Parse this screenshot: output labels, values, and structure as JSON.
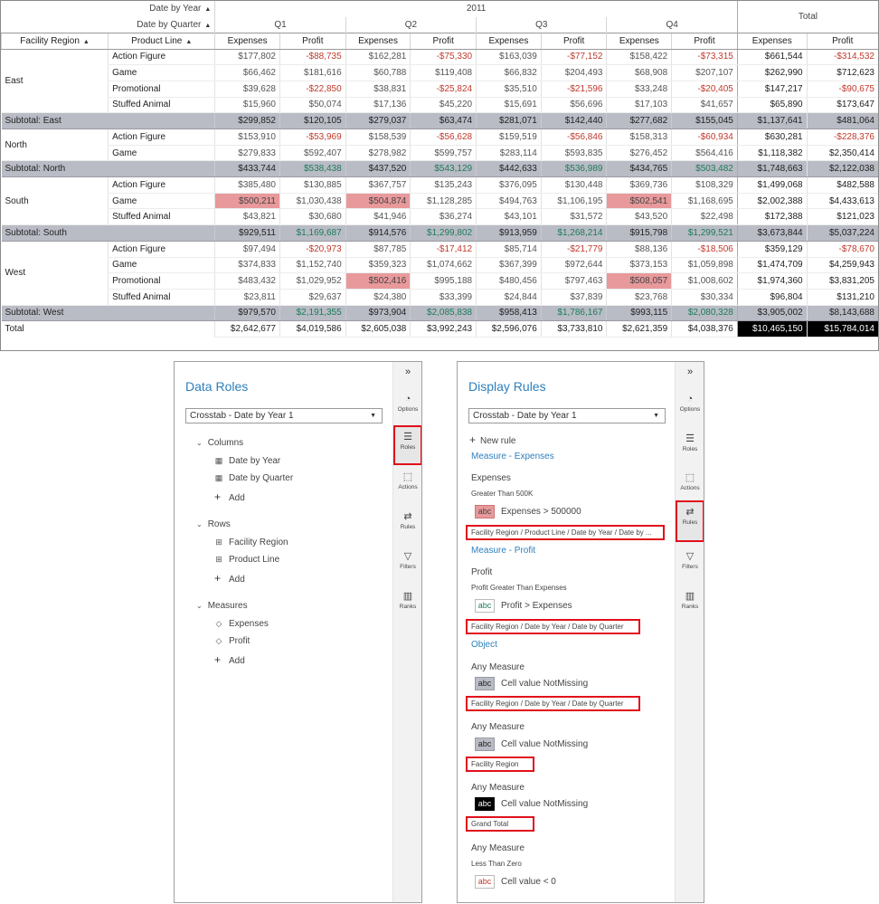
{
  "crosstab": {
    "col_dims": [
      "Date by Year",
      "Date by Quarter"
    ],
    "year": "2011",
    "quarters": [
      "Q1",
      "Q2",
      "Q3",
      "Q4"
    ],
    "total_label": "Total",
    "row_headers": [
      "Facility Region",
      "Product Line"
    ],
    "measures": [
      "Expenses",
      "Profit"
    ],
    "rows": [
      {
        "type": "data",
        "region": "East",
        "product": "Action Figure",
        "values": [
          "$177,802",
          "-$88,735",
          "$162,281",
          "-$75,330",
          "$163,039",
          "-$77,152",
          "$158,422",
          "-$73,315"
        ],
        "totals": [
          "$661,544",
          "-$314,532"
        ]
      },
      {
        "type": "data",
        "region": "",
        "product": "Game",
        "values": [
          "$66,462",
          "$181,616",
          "$60,788",
          "$119,408",
          "$66,832",
          "$204,493",
          "$68,908",
          "$207,107"
        ],
        "totals": [
          "$262,990",
          "$712,623"
        ]
      },
      {
        "type": "data",
        "region": "",
        "product": "Promotional",
        "values": [
          "$39,628",
          "-$22,850",
          "$38,831",
          "-$25,824",
          "$35,510",
          "-$21,596",
          "$33,248",
          "-$20,405"
        ],
        "totals": [
          "$147,217",
          "-$90,675"
        ]
      },
      {
        "type": "data",
        "region": "",
        "product": "Stuffed Animal",
        "values": [
          "$15,960",
          "$50,074",
          "$17,136",
          "$45,220",
          "$15,691",
          "$56,696",
          "$17,103",
          "$41,657"
        ],
        "totals": [
          "$65,890",
          "$173,647"
        ]
      },
      {
        "type": "sub",
        "label": "Subtotal: East",
        "values": [
          "$299,852",
          "$120,105",
          "$279,037",
          "$63,474",
          "$281,071",
          "$142,440",
          "$277,682",
          "$155,045"
        ],
        "totals": [
          "$1,137,641",
          "$481,064"
        ]
      },
      {
        "type": "data",
        "region": "North",
        "product": "Action Figure",
        "values": [
          "$153,910",
          "-$53,969",
          "$158,539",
          "-$56,628",
          "$159,519",
          "-$56,846",
          "$158,313",
          "-$60,934"
        ],
        "totals": [
          "$630,281",
          "-$228,376"
        ]
      },
      {
        "type": "data",
        "region": "",
        "product": "Game",
        "values": [
          "$279,833",
          "$592,407",
          "$278,982",
          "$599,757",
          "$283,114",
          "$593,835",
          "$276,452",
          "$564,416"
        ],
        "totals": [
          "$1,118,382",
          "$2,350,414"
        ]
      },
      {
        "type": "sub",
        "label": "Subtotal: North",
        "values": [
          "$433,744",
          "$538,438",
          "$437,520",
          "$543,129",
          "$442,633",
          "$536,989",
          "$434,765",
          "$503,482"
        ],
        "totals": [
          "$1,748,663",
          "$2,122,038"
        ]
      },
      {
        "type": "data",
        "region": "South",
        "product": "Action Figure",
        "values": [
          "$385,480",
          "$130,885",
          "$367,757",
          "$135,243",
          "$376,095",
          "$130,448",
          "$369,736",
          "$108,329"
        ],
        "totals": [
          "$1,499,068",
          "$482,588"
        ]
      },
      {
        "type": "data",
        "region": "",
        "product": "Game",
        "values": [
          "$500,211",
          "$1,030,438",
          "$504,874",
          "$1,128,285",
          "$494,763",
          "$1,106,195",
          "$502,541",
          "$1,168,695"
        ],
        "totals": [
          "$2,002,388",
          "$4,433,613"
        ]
      },
      {
        "type": "data",
        "region": "",
        "product": "Stuffed Animal",
        "values": [
          "$43,821",
          "$30,680",
          "$41,946",
          "$36,274",
          "$43,101",
          "$31,572",
          "$43,520",
          "$22,498"
        ],
        "totals": [
          "$172,388",
          "$121,023"
        ]
      },
      {
        "type": "sub",
        "label": "Subtotal: South",
        "values": [
          "$929,511",
          "$1,169,687",
          "$914,576",
          "$1,299,802",
          "$913,959",
          "$1,268,214",
          "$915,798",
          "$1,299,521"
        ],
        "totals": [
          "$3,673,844",
          "$5,037,224"
        ]
      },
      {
        "type": "data",
        "region": "West",
        "product": "Action Figure",
        "values": [
          "$97,494",
          "-$20,973",
          "$87,785",
          "-$17,412",
          "$85,714",
          "-$21,779",
          "$88,136",
          "-$18,506"
        ],
        "totals": [
          "$359,129",
          "-$78,670"
        ]
      },
      {
        "type": "data",
        "region": "",
        "product": "Game",
        "values": [
          "$374,833",
          "$1,152,740",
          "$359,323",
          "$1,074,662",
          "$367,399",
          "$972,644",
          "$373,153",
          "$1,059,898"
        ],
        "totals": [
          "$1,474,709",
          "$4,259,943"
        ]
      },
      {
        "type": "data",
        "region": "",
        "product": "Promotional",
        "values": [
          "$483,432",
          "$1,029,952",
          "$502,416",
          "$995,188",
          "$480,456",
          "$797,463",
          "$508,057",
          "$1,008,602"
        ],
        "totals": [
          "$1,974,360",
          "$3,831,205"
        ]
      },
      {
        "type": "data",
        "region": "",
        "product": "Stuffed Animal",
        "values": [
          "$23,811",
          "$29,637",
          "$24,380",
          "$33,399",
          "$24,844",
          "$37,839",
          "$23,768",
          "$30,334"
        ],
        "totals": [
          "$96,804",
          "$131,210"
        ]
      },
      {
        "type": "sub",
        "label": "Subtotal: West",
        "values": [
          "$979,570",
          "$2,191,355",
          "$973,904",
          "$2,085,838",
          "$958,413",
          "$1,786,167",
          "$993,115",
          "$2,080,328"
        ],
        "totals": [
          "$3,905,002",
          "$8,143,688"
        ]
      },
      {
        "type": "grand",
        "label": "Total",
        "values": [
          "$2,642,677",
          "$4,019,586",
          "$2,605,038",
          "$3,992,243",
          "$2,596,076",
          "$3,733,810",
          "$2,621,359",
          "$4,038,376"
        ],
        "totals": [
          "$10,465,150",
          "$15,784,014"
        ]
      }
    ],
    "colors": {
      "highlight": "#e8999b",
      "subtotal_bg": "#b9bcc5",
      "negative": "#c0392b",
      "positive_sub": "#1f7a5a",
      "grand_bg": "#000000"
    }
  },
  "data_roles": {
    "title": "Data Roles",
    "dropdown": "Crosstab - Date by Year 1",
    "sections": [
      {
        "label": "Columns",
        "items": [
          "Date by Year",
          "Date by Quarter"
        ],
        "icon": "calendar-icon"
      },
      {
        "label": "Rows",
        "items": [
          "Facility Region",
          "Product Line"
        ],
        "icon": "hierarchy-icon"
      },
      {
        "label": "Measures",
        "items": [
          "Expenses",
          "Profit"
        ],
        "icon": "measure-icon"
      }
    ],
    "add_label": "Add"
  },
  "display_rules": {
    "title": "Display Rules",
    "dropdown": "Crosstab - Date by Year 1",
    "new_rule": "New rule",
    "groups": [
      {
        "link": "Measure - Expenses",
        "name": "Expenses",
        "subtitle": "Greater Than 500K",
        "swatch": "abc",
        "condition": "Expenses > 500000",
        "scope": "Facility Region / Product Line / Date by Year / Date by ..."
      },
      {
        "link": "Measure - Profit",
        "name": "Profit",
        "subtitle": "Profit Greater Than Expenses",
        "swatch": "abc",
        "condition": "Profit > Expenses",
        "scope": "Facility Region / Date by Year / Date by Quarter"
      },
      {
        "link": "Object",
        "name": "Any Measure",
        "subtitle": "",
        "swatch": "abc",
        "condition": "Cell value NotMissing",
        "scope": "Facility Region / Date by Year / Date by Quarter"
      },
      {
        "link": "",
        "name": "Any Measure",
        "subtitle": "",
        "swatch": "abc",
        "condition": "Cell value NotMissing",
        "scope": "Facility Region"
      },
      {
        "link": "",
        "name": "Any Measure",
        "subtitle": "",
        "swatch": "abc",
        "condition": "Cell value NotMissing",
        "scope": "Grand Total"
      },
      {
        "link": "",
        "name": "Any Measure",
        "subtitle": "Less Than Zero",
        "swatch": "abc",
        "condition": "Cell value < 0",
        "scope": ""
      }
    ]
  },
  "toolbar": {
    "collapse": "»",
    "buttons": [
      {
        "label": "Options",
        "icon": "palette-icon"
      },
      {
        "label": "Roles",
        "icon": "roles-icon"
      },
      {
        "label": "Actions",
        "icon": "actions-icon"
      },
      {
        "label": "Rules",
        "icon": "rules-icon"
      },
      {
        "label": "Filters",
        "icon": "filter-icon"
      },
      {
        "label": "Ranks",
        "icon": "ranks-icon"
      }
    ]
  }
}
